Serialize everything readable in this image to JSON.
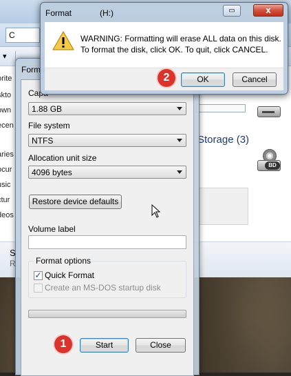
{
  "explorer": {
    "address_partial": "C",
    "nav_items": [
      "orite",
      "skto",
      "own",
      "ecen",
      "aries",
      "ocur",
      "usic",
      "ctur",
      "deos"
    ],
    "drive_bar_label": "",
    "storage_heading": "Storage (3)",
    "status_line1": "S",
    "status_line2": "R"
  },
  "format_dialog": {
    "title": "Forma",
    "capacity_label": "Capa",
    "capacity_value": "1.88 GB",
    "filesystem_label": "File system",
    "filesystem_value": "NTFS",
    "allocation_label": "Allocation unit size",
    "allocation_value": "4096 bytes",
    "restore_button": "Restore device defaults",
    "volume_label": "Volume label",
    "volume_value": "",
    "format_options_title": "Format options",
    "quick_format_label": "Quick Format",
    "quick_format_checked": true,
    "msdos_label": "Create an MS-DOS startup disk",
    "msdos_checked": false,
    "progress": 0,
    "start_button": "Start",
    "close_button": "Close"
  },
  "warning_dialog": {
    "title": "Format",
    "title_drive": "(H:)",
    "close_glyph": "x",
    "message_line1": "WARNING: Formatting will erase ALL data on this disk.",
    "message_line2": "To format the disk, click OK. To quit, click CANCEL.",
    "ok_button": "OK",
    "cancel_button": "Cancel"
  },
  "annotations": {
    "step1": "1",
    "step2": "2",
    "color": "#d9332c"
  }
}
